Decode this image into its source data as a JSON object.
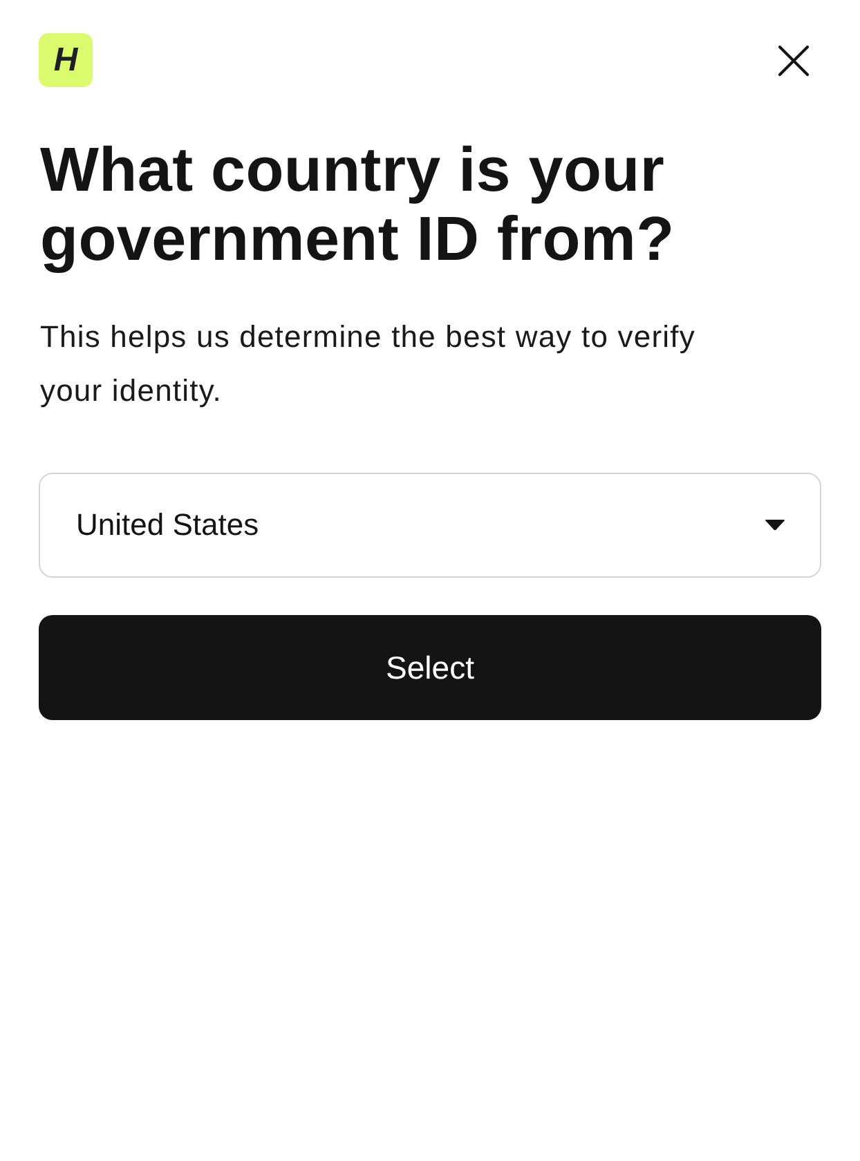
{
  "logo": {
    "text": "H"
  },
  "title": "What country is your government ID from?",
  "description": "This helps us determine the best way to verify your identity.",
  "country_select": {
    "value": "United States"
  },
  "submit_button": {
    "label": "Select"
  }
}
